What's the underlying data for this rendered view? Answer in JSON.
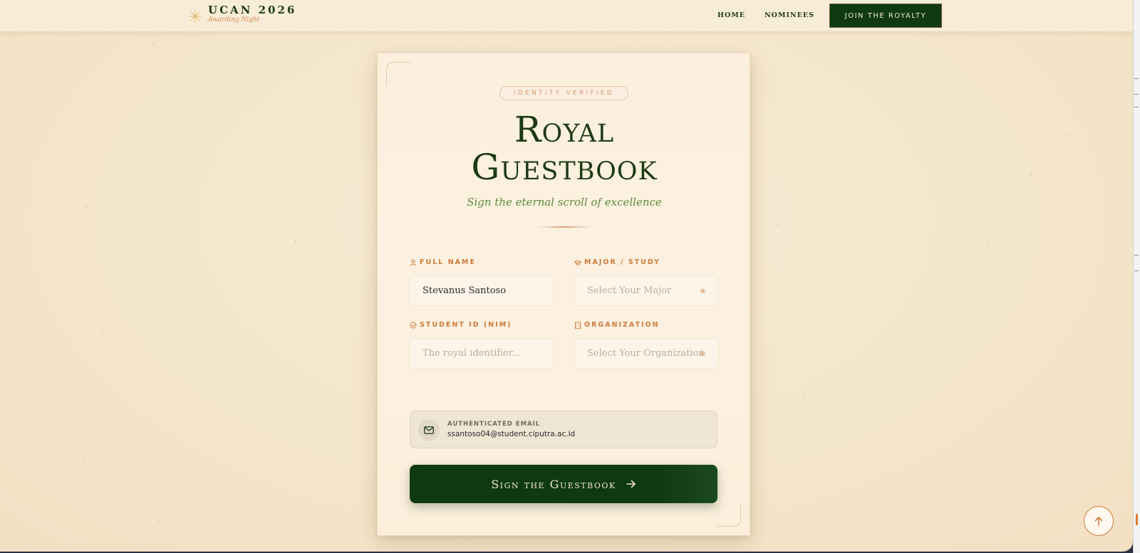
{
  "brand": {
    "title": "UCAN 2026",
    "subtitle": "Awarding Night"
  },
  "nav": {
    "home": "HOME",
    "nominees": "NOMINEES",
    "cta": "JOIN THE ROYALTY"
  },
  "card": {
    "badge": "IDENTITY VERIFIED",
    "title_line1": "Royal",
    "title_line2": "Guestbook",
    "subtitle": "Sign the eternal scroll of excellence"
  },
  "form": {
    "full_name": {
      "label": "FULL NAME",
      "value": "Stevanus Santoso",
      "icon": "user-icon"
    },
    "major": {
      "label": "MAJOR / STUDY",
      "placeholder": "Select Your Major",
      "icon": "graduation-cap-icon"
    },
    "student_id": {
      "label": "STUDENT ID (NIM)",
      "placeholder": "The royal identifier...",
      "icon": "badge-check-icon"
    },
    "organization": {
      "label": "ORGANIZATION",
      "placeholder": "Select Your Organization",
      "icon": "building-icon"
    },
    "required_mark": "★"
  },
  "email": {
    "label": "AUTHENTICATED EMAIL",
    "value": "ssantoso04@student.ciputra.ac.id",
    "icon": "mail-icon"
  },
  "submit": {
    "label": "Sign the Guestbook",
    "icon": "arrow-right-icon"
  },
  "scroll_top": {
    "icon": "arrow-up-icon"
  },
  "colors": {
    "primary_green": "#0f3a12",
    "accent_orange": "#d07b3c",
    "background": "#f4e6cc",
    "card": "#fbf0de"
  }
}
